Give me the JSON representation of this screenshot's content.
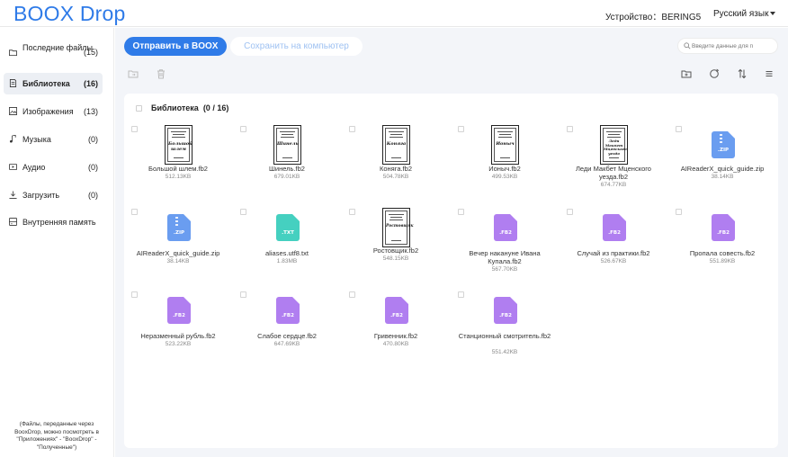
{
  "header": {
    "logo_text": "BOOX Drop",
    "device_label": "Устройство：BERING5",
    "language": "Русский язык"
  },
  "sidebar": {
    "items": [
      {
        "label": "Последние файлы",
        "count": "(15)",
        "icon": "folder-icon",
        "active": false
      },
      {
        "label": "Библиотека",
        "count": "(16)",
        "icon": "book-icon",
        "active": true
      },
      {
        "label": "Изображения",
        "count": "(13)",
        "icon": "image-icon",
        "active": false
      },
      {
        "label": "Музыка",
        "count": "(0)",
        "icon": "music-note-icon",
        "active": false
      },
      {
        "label": "Аудио",
        "count": "(0)",
        "icon": "audio-icon",
        "active": false
      },
      {
        "label": "Загрузить",
        "count": "(0)",
        "icon": "download-icon",
        "active": false
      },
      {
        "label": "Внутренняя память",
        "count": "",
        "icon": "storage-icon",
        "active": false
      }
    ],
    "note": "(Файлы, переданные через BooxDrop, можно посмотреть в \"Приложениях\" - \"BooxDrop\" - \"Полученные\")"
  },
  "toolbar": {
    "send_label": "Отправить в BOOX",
    "save_label": "Сохранить на компьютер",
    "search_placeholder": "Введите данные для п"
  },
  "library": {
    "title": "Библиотека",
    "count": "(0 / 16)",
    "files": [
      {
        "name": "Большой шлем.fb2",
        "size": "512.13KB",
        "type": "cover",
        "cover_title": "Большой шлем"
      },
      {
        "name": "Шинель.fb2",
        "size": "679.01KB",
        "type": "cover",
        "cover_title": "Шинель"
      },
      {
        "name": "Коняга.fb2",
        "size": "504.78KB",
        "type": "cover",
        "cover_title": "Коняга"
      },
      {
        "name": "Ионыч.fb2",
        "size": "499.53KB",
        "type": "cover",
        "cover_title": "Ионыч"
      },
      {
        "name": "Леди Макбет Мценского уезда.fb2",
        "size": "674.77KB",
        "type": "cover",
        "cover_title": "Леди Макбет Мценского уезда"
      },
      {
        "name": "AIReaderX_quick_guide.zip",
        "size": "38.14KB",
        "type": "zip",
        "ext": ".ZIP"
      },
      {
        "name": "AIReaderX_quick_guide.zip",
        "size": "38.14KB",
        "type": "zip",
        "ext": ".ZIP"
      },
      {
        "name": "aliases.utf8.txt",
        "size": "1.83MB",
        "type": "txt",
        "ext": ".TXT"
      },
      {
        "name": "Ростовщик.fb2",
        "size": "548.15KB",
        "type": "cover",
        "cover_title": "Ростовщик"
      },
      {
        "name": "Вечер накануне Ивана Купала.fb2",
        "size": "567.70KB",
        "type": "fb2",
        "ext": ".FB2"
      },
      {
        "name": "Случай из практики.fb2",
        "size": "526.67KB",
        "type": "fb2",
        "ext": ".FB2"
      },
      {
        "name": "Пропала совесть.fb2",
        "size": "551.89KB",
        "type": "fb2",
        "ext": ".FB2"
      },
      {
        "name": "Неразменный рубль.fb2",
        "size": "523.22KB",
        "type": "fb2",
        "ext": ".FB2"
      },
      {
        "name": "Слабое сердце.fb2",
        "size": "647.69KB",
        "type": "fb2",
        "ext": ".FB2"
      },
      {
        "name": "Гривенник.fb2",
        "size": "470.80KB",
        "type": "fb2",
        "ext": ".FB2"
      },
      {
        "name": "Станционный смотритель.fb2",
        "size": "551.42KB",
        "type": "fb2",
        "ext": ".FB2"
      }
    ]
  },
  "colors": {
    "accent": "#2f7be8",
    "zip": "#6a9df0",
    "txt": "#45d0c0",
    "fb2": "#b07ef0"
  }
}
